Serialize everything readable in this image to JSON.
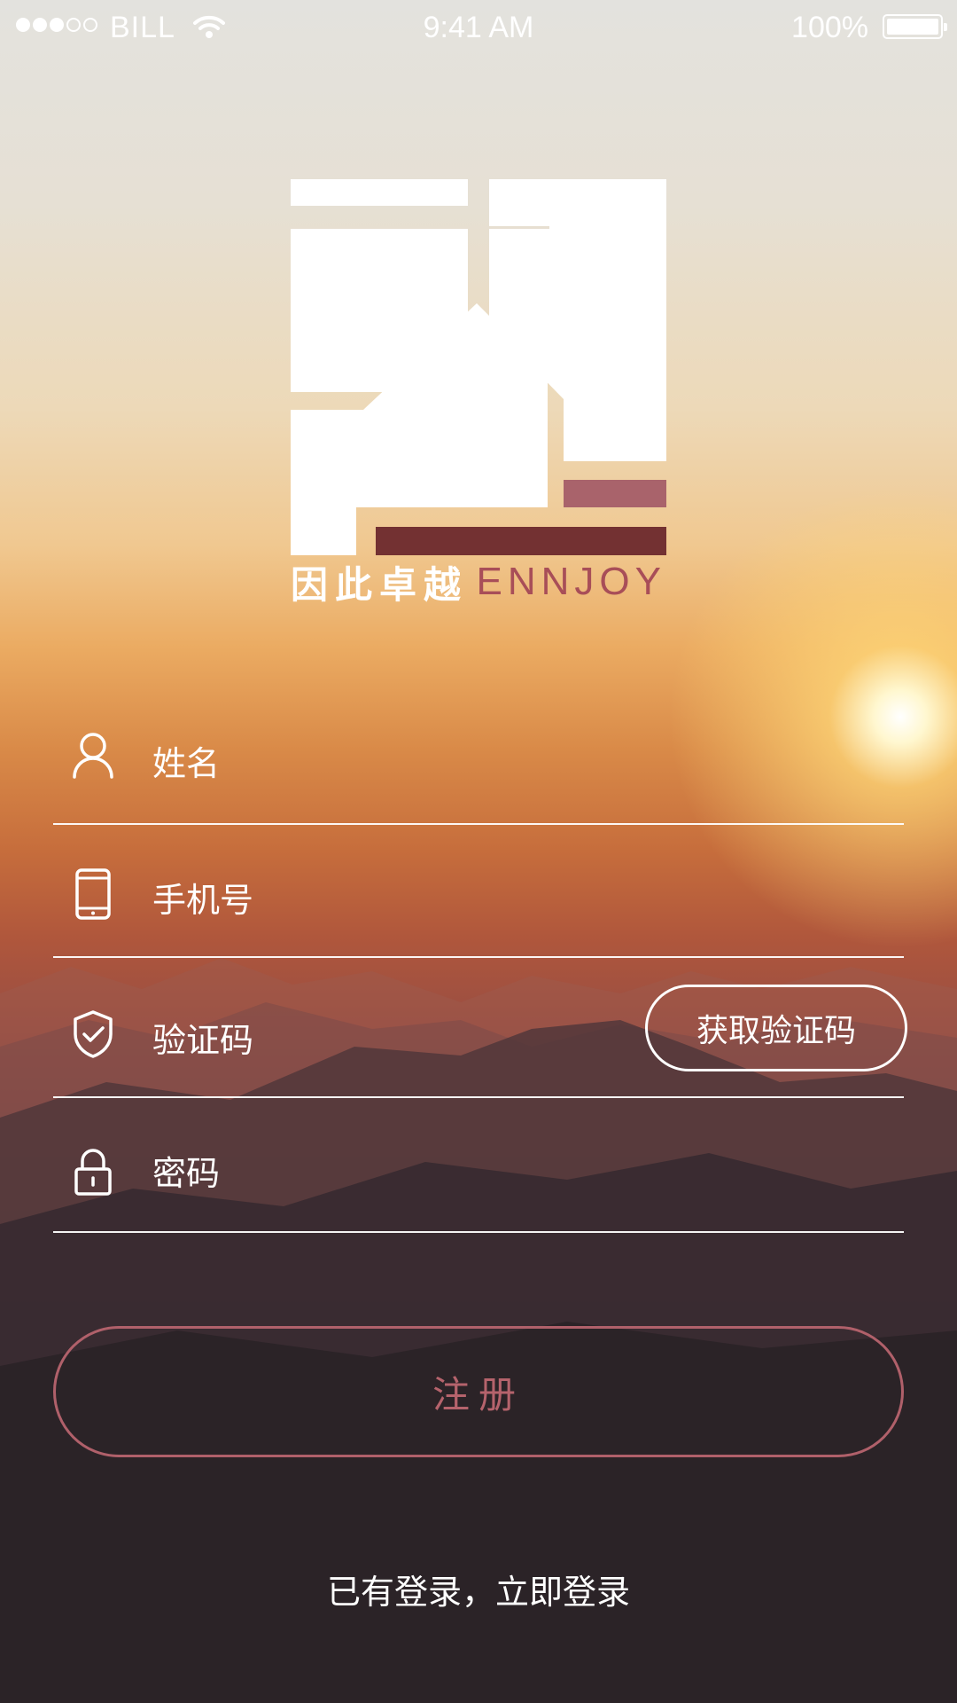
{
  "status_bar": {
    "carrier": "BILL",
    "time": "9:41 AM",
    "battery": "100%",
    "signal_bars_filled": 3,
    "signal_bars_total": 5
  },
  "logo": {
    "cn_text": "因此卓越",
    "en_text": "ENNJOY",
    "colors": {
      "mark": "#ffffff",
      "accent_light": "#a9636b",
      "accent_dark": "#733132"
    }
  },
  "form": {
    "name": {
      "label": "姓名",
      "icon": "user-icon"
    },
    "phone": {
      "label": "手机号",
      "icon": "phone-icon"
    },
    "code": {
      "label": "验证码",
      "icon": "shield-check-icon",
      "button": "获取验证码"
    },
    "password": {
      "label": "密码",
      "icon": "lock-icon"
    }
  },
  "actions": {
    "register": "注册",
    "login_link": "已有登录，立即登录"
  },
  "colors": {
    "register_accent": "#b5636c"
  }
}
